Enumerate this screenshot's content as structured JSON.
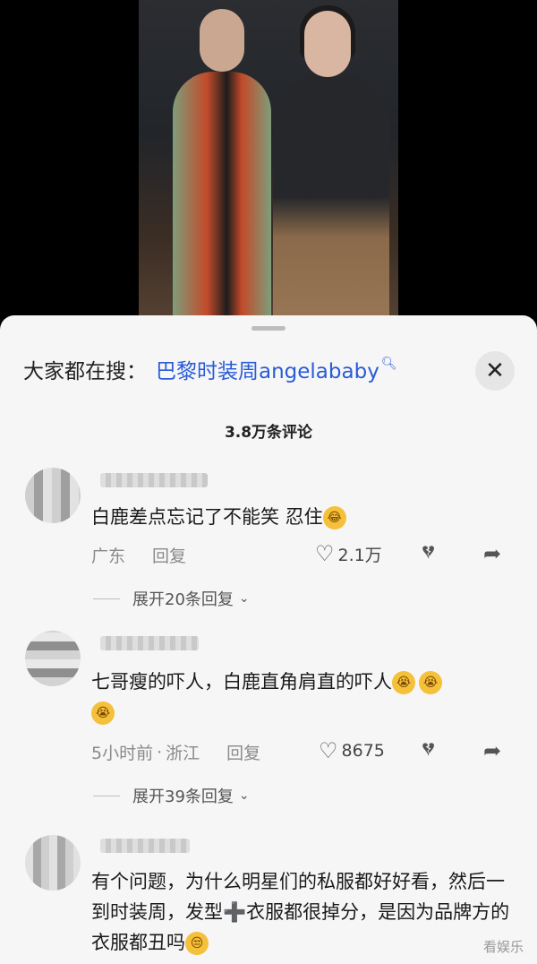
{
  "search": {
    "prefix": "大家都在搜：",
    "keyword": "巴黎时装周angelababy",
    "mag_icon": "search-icon"
  },
  "comments_count": "3.8万条评论",
  "comments": [
    {
      "text": "白鹿差点忘记了不能笑  忍住",
      "emoji": "😂",
      "location": "广东",
      "reply_label": "回复",
      "likes": "2.1万",
      "expand": "展开20条回复"
    },
    {
      "text": "七哥瘦的吓人，白鹿直角肩直的吓人",
      "emoji": "😭",
      "time": "5小时前",
      "location": "浙江",
      "reply_label": "回复",
      "likes": "8675",
      "expand": "展开39条回复"
    },
    {
      "text_part1": "有个问题，为什么明星们的私服都好好看，然后一到时装周，发型",
      "plus": "➕",
      "text_part2": "衣服都很掉分，是因为品牌方的衣服都丑吗",
      "emoji": "😒"
    }
  ],
  "watermark": "看娱乐",
  "accent_color": "#2a5bd7"
}
